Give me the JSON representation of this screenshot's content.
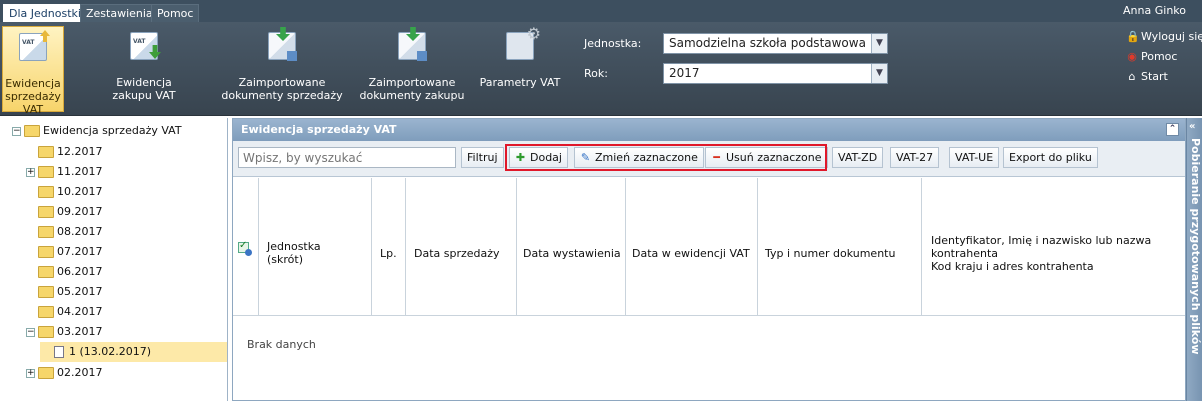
{
  "menu": {
    "tabs": [
      {
        "label": "Dla Jednostki",
        "active": true
      },
      {
        "label": "Zestawienia",
        "active": false
      },
      {
        "label": "Pomoc",
        "active": false
      }
    ],
    "user": "Anna Ginko"
  },
  "ribbon": {
    "buttons": [
      {
        "label": "Ewidencja sprzedaży VAT",
        "icon": "vat-sales-icon",
        "active": true
      },
      {
        "label": "Ewidencja zakupu VAT",
        "icon": "vat-purchase-icon",
        "active": false
      },
      {
        "label": "Zaimportowane dokumenty sprzedaży",
        "icon": "import-sales-icon",
        "active": false
      },
      {
        "label": "Zaimportowane dokumenty zakupu",
        "icon": "import-purchase-icon",
        "active": false
      },
      {
        "label": "Parametry VAT",
        "icon": "vat-params-icon",
        "active": false
      }
    ],
    "unit_label": "Jednostka:",
    "unit_value": "Samodzielna szkoła podstawowa",
    "year_label": "Rok:",
    "year_value": "2017",
    "links": {
      "logout": "Wyloguj się",
      "help": "Pomoc",
      "start": "Start"
    }
  },
  "tree": {
    "root": "Ewidencja sprzedaży VAT",
    "items": [
      "12.2017",
      "11.2017",
      "10.2017",
      "09.2017",
      "08.2017",
      "07.2017",
      "06.2017",
      "05.2017",
      "04.2017",
      "03.2017"
    ],
    "child": "1 (13.02.2017)",
    "last": "02.2017"
  },
  "panel": {
    "title": "Ewidencja sprzedaży VAT",
    "search_placeholder": "Wpisz, by wyszukać",
    "filter": "Filtruj",
    "add": "Dodaj",
    "edit": "Zmień zaznaczone",
    "delete": "Usuń zaznaczone",
    "vat_zd": "VAT-ZD",
    "vat_27": "VAT-27",
    "vat_ue": "VAT-UE",
    "export": "Export do pliku",
    "columns": {
      "unit": "Jednostka (skrót)",
      "lp": "Lp.",
      "sale_date": "Data sprzedaży",
      "issue_date": "Data wystawienia",
      "vat_date": "Data w ewidencji VAT",
      "doc": "Typ i numer dokumentu",
      "contractor_1": "Identyfikator, Imię i nazwisko lub nazwa",
      "contractor_2": "kontrahenta",
      "contractor_3": "Kod kraju i adres kontrahenta"
    },
    "empty": "Brak danych"
  },
  "sidebar": {
    "title": "Pobieranie przygotowanych plików"
  }
}
